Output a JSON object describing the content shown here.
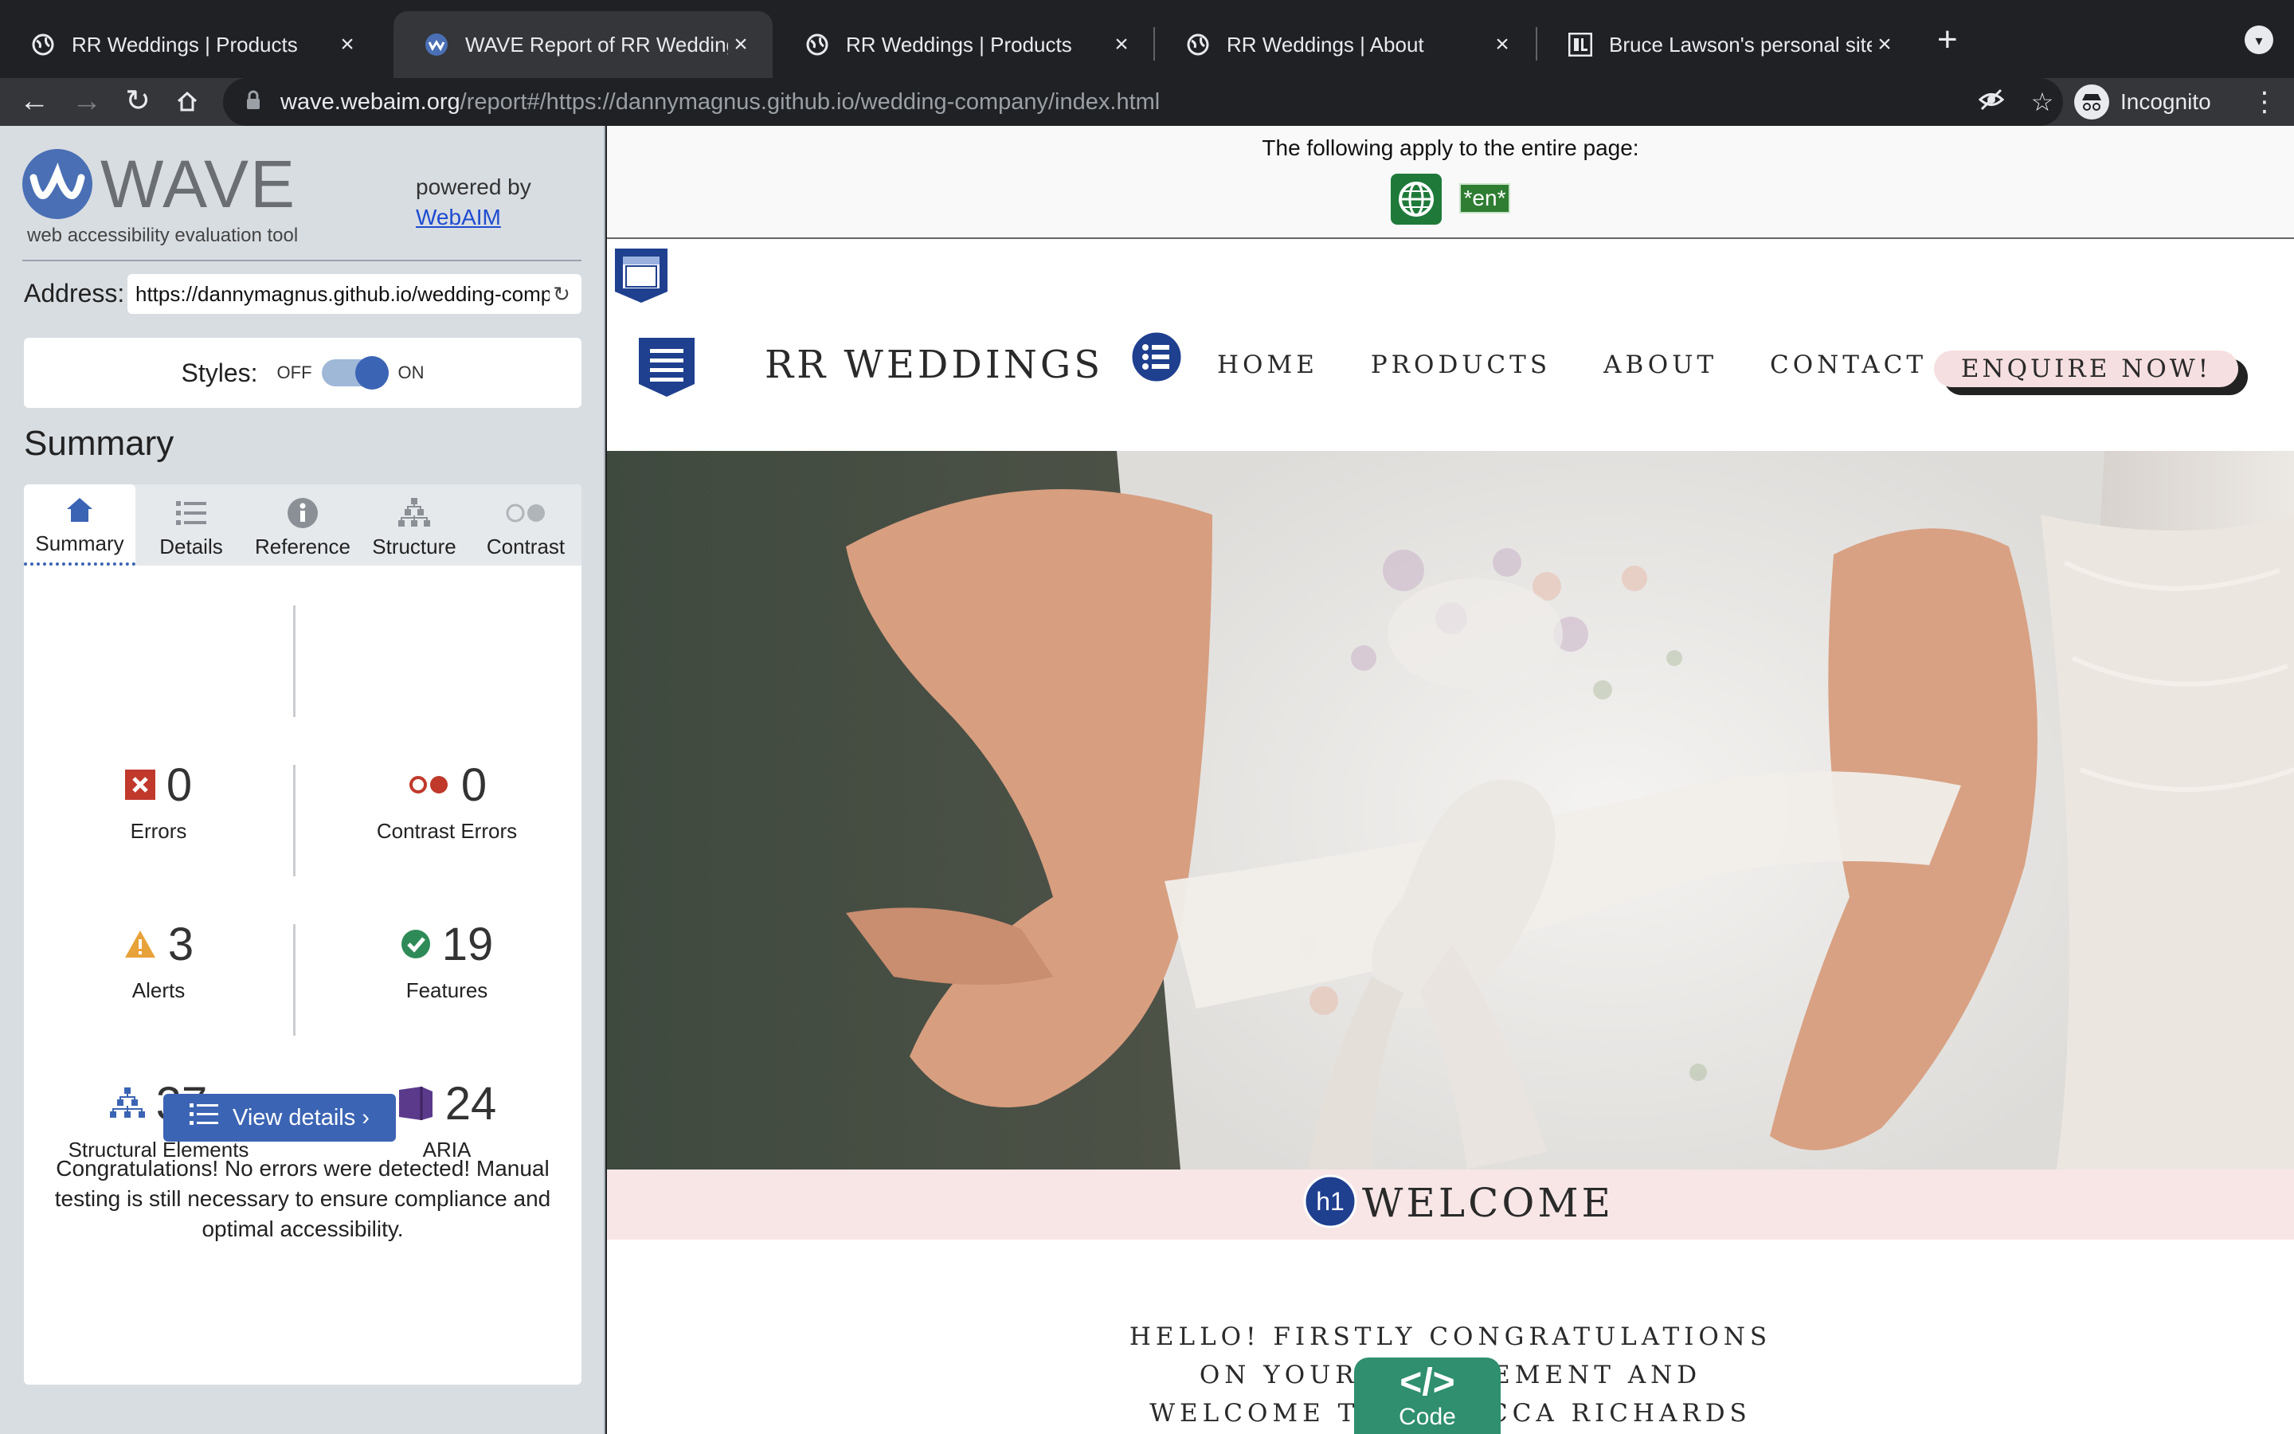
{
  "browser": {
    "tabs": [
      {
        "title": "RR Weddings | Products",
        "active": false,
        "favicon": "globe-icon"
      },
      {
        "title": "WAVE Report of RR Weddings |",
        "active": true,
        "favicon": "wave-icon"
      },
      {
        "title": "RR Weddings | Products",
        "active": false,
        "favicon": "globe-icon"
      },
      {
        "title": "RR Weddings | About",
        "active": false,
        "favicon": "globe-icon"
      },
      {
        "title": "Bruce Lawson's personal site",
        "active": false,
        "favicon": "bl-icon"
      }
    ],
    "url_host": "wave.webaim.org",
    "url_rest": "/report#/https://dannymagnus.github.io/wedding-company/index.html",
    "profile_label": "Incognito"
  },
  "wave": {
    "logo_text": "WAVE",
    "tagline": "web accessibility evaluation tool",
    "powered_by": "powered by",
    "webaim_link": "WebAIM",
    "address_label": "Address:",
    "address_value": "https://dannymagnus.github.io/wedding-company/index.html",
    "styles_label": "Styles:",
    "styles_off": "OFF",
    "styles_on": "ON",
    "summary_heading": "Summary",
    "tabs": [
      "Summary",
      "Details",
      "Reference",
      "Structure",
      "Contrast"
    ],
    "stats": {
      "errors": {
        "value": "0",
        "label": "Errors"
      },
      "contrast": {
        "value": "0",
        "label": "Contrast Errors"
      },
      "alerts": {
        "value": "3",
        "label": "Alerts"
      },
      "features": {
        "value": "19",
        "label": "Features"
      },
      "structural": {
        "value": "37",
        "label": "Structural Elements"
      },
      "aria": {
        "value": "24",
        "label": "ARIA"
      }
    },
    "view_details": "View details ›",
    "congrats": "Congratulations! No errors were detected! Manual testing is still necessary to ensure compliance and optimal accessibility."
  },
  "preview": {
    "apply_text": "The following apply to the entire page:",
    "lang_tag": "*en*",
    "brand": "RR WEDDINGS",
    "nav": [
      "HOME",
      "PRODUCTS",
      "ABOUT",
      "CONTACT"
    ],
    "enquire": "ENQUIRE NOW!",
    "h1_badge": "h1",
    "welcome": "WELCOME",
    "intro_lines": [
      "HELLO! FIRSTLY CONGRATULATIONS",
      "ON YOUR ENGAGEMENT AND",
      "WELCOME TO REBECCA RICHARDS"
    ],
    "code_symbol": "</>",
    "code_label": "Code"
  },
  "colors": {
    "wave_blue": "#3c64b4",
    "error_red": "#c0392b",
    "alert_orange": "#e8a23a",
    "feature_green": "#2e8b57",
    "aria_purple": "#5b3a8c",
    "welcome_band": "#f8e6e6"
  }
}
